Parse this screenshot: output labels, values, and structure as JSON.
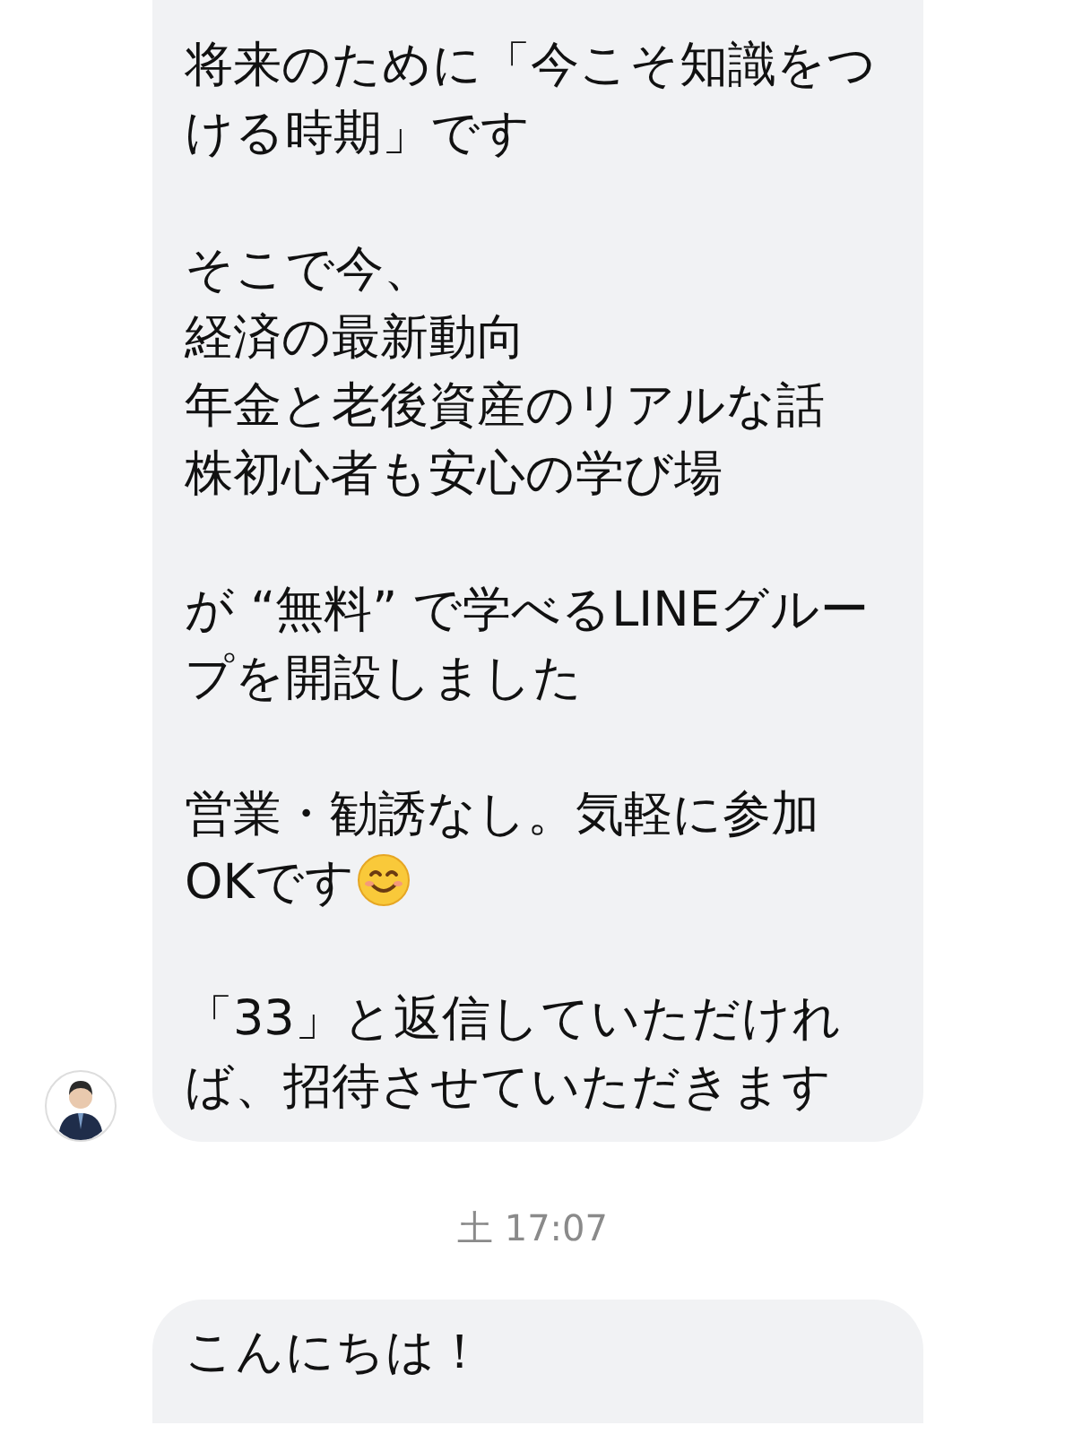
{
  "messages": [
    {
      "kind": "bubble",
      "avatar": true,
      "paragraphs": [
        {
          "lines": [
            "将来のために「今こそ知識をつける時期」です"
          ]
        },
        {
          "lines": [
            "そこで今、",
            "経済の最新動向",
            "年金と老後資産のリアルな話",
            "株初心者も安心の学び場"
          ]
        },
        {
          "lines": [
            "が “無料” で学べるLINEグループを開設しました"
          ]
        },
        {
          "lines": [
            "営業・勧誘なし。気軽に参加OKです"
          ],
          "trailing_emoji": true
        },
        {
          "lines": [
            "「33」と返信していただければ、招待させていただきます"
          ]
        }
      ]
    },
    {
      "kind": "timestamp",
      "text": "土 17:07"
    },
    {
      "kind": "bubble",
      "avatar": false,
      "paragraphs": [
        {
          "lines": [
            "こんにちは！"
          ]
        }
      ]
    }
  ]
}
